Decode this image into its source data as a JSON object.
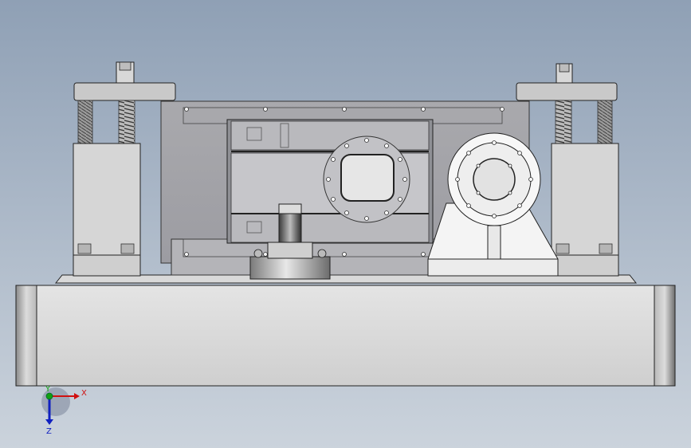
{
  "viewport": {
    "background_top": "#8fa0b5",
    "background_bottom": "#cbd3dc",
    "model_description_visible": false
  },
  "triad": {
    "x_label": "X",
    "y_label": "Y",
    "z_label": "Z",
    "x_color": "#d01010",
    "y_color": "#10a010",
    "z_color": "#1020c0"
  }
}
